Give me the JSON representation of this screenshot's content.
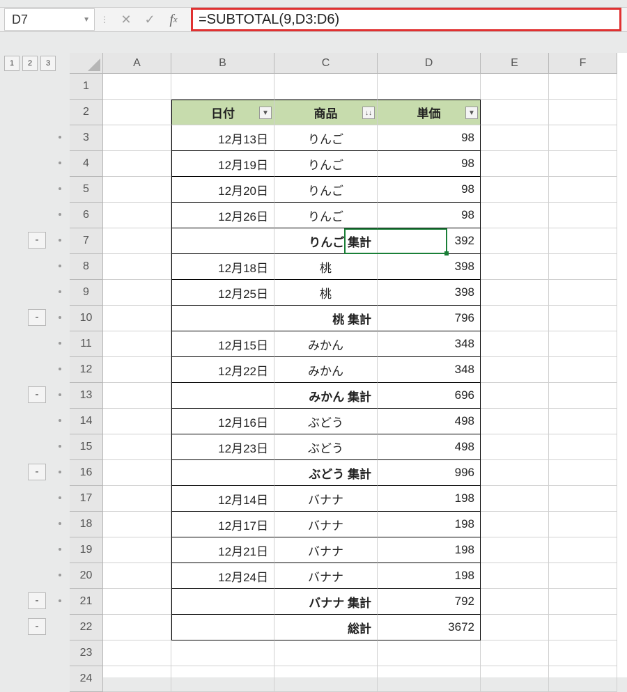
{
  "namebox": {
    "value": "D7"
  },
  "formula": "=SUBTOTAL(9,D3:D6)",
  "outline_levels": [
    "1",
    "2",
    "3"
  ],
  "columns": [
    "A",
    "B",
    "C",
    "D",
    "E",
    "F"
  ],
  "headers": {
    "date": "日付",
    "product": "商品",
    "price": "単価"
  },
  "filter_glyph": {
    "down": "▼",
    "sort": "↓↓"
  },
  "rows": [
    {
      "n": "1"
    },
    {
      "n": "2",
      "hdr": true
    },
    {
      "n": "3",
      "date": "12月13日",
      "prod": "りんご",
      "price": "98",
      "dot": true
    },
    {
      "n": "4",
      "date": "12月19日",
      "prod": "りんご",
      "price": "98",
      "dot": true
    },
    {
      "n": "5",
      "date": "12月20日",
      "prod": "りんご",
      "price": "98",
      "dot": true
    },
    {
      "n": "6",
      "date": "12月26日",
      "prod": "りんご",
      "price": "98",
      "dot": true
    },
    {
      "n": "7",
      "prod": "りんご 集計",
      "price": "392",
      "sub": true,
      "collapse": true
    },
    {
      "n": "8",
      "date": "12月18日",
      "prod": "桃",
      "price": "398",
      "dot": true
    },
    {
      "n": "9",
      "date": "12月25日",
      "prod": "桃",
      "price": "398",
      "dot": true
    },
    {
      "n": "10",
      "prod": "桃 集計",
      "price": "796",
      "sub": true,
      "collapse": true
    },
    {
      "n": "11",
      "date": "12月15日",
      "prod": "みかん",
      "price": "348",
      "dot": true
    },
    {
      "n": "12",
      "date": "12月22日",
      "prod": "みかん",
      "price": "348",
      "dot": true
    },
    {
      "n": "13",
      "prod": "みかん 集計",
      "price": "696",
      "sub": true,
      "collapse": true
    },
    {
      "n": "14",
      "date": "12月16日",
      "prod": "ぶどう",
      "price": "498",
      "dot": true
    },
    {
      "n": "15",
      "date": "12月23日",
      "prod": "ぶどう",
      "price": "498",
      "dot": true
    },
    {
      "n": "16",
      "prod": "ぶどう 集計",
      "price": "996",
      "sub": true,
      "collapse": true
    },
    {
      "n": "17",
      "date": "12月14日",
      "prod": "バナナ",
      "price": "198",
      "dot": true
    },
    {
      "n": "18",
      "date": "12月17日",
      "prod": "バナナ",
      "price": "198",
      "dot": true
    },
    {
      "n": "19",
      "date": "12月21日",
      "prod": "バナナ",
      "price": "198",
      "dot": true
    },
    {
      "n": "20",
      "date": "12月24日",
      "prod": "バナナ",
      "price": "198",
      "dot": true
    },
    {
      "n": "21",
      "prod": "バナナ 集計",
      "price": "792",
      "sub": true,
      "collapse": true
    },
    {
      "n": "22",
      "prod": "総計",
      "price": "3672",
      "sub": true,
      "grand": true
    },
    {
      "n": "23"
    },
    {
      "n": "24"
    }
  ],
  "selected_cell": "D7"
}
